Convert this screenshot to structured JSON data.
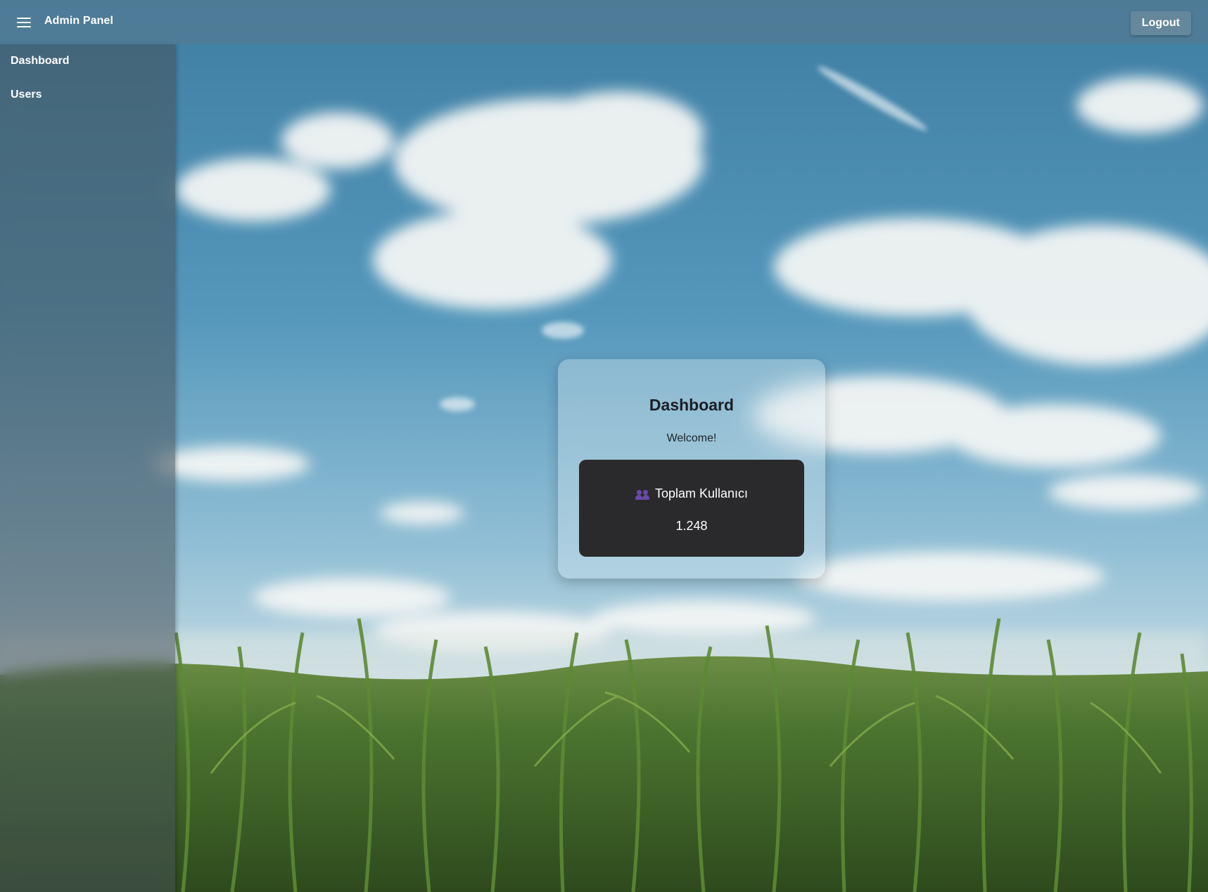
{
  "header": {
    "title": "Admin Panel",
    "menu_icon": "hamburger-menu-icon",
    "logout_label": "Logout"
  },
  "sidebar": {
    "items": [
      {
        "label": "Dashboard"
      },
      {
        "label": "Users"
      }
    ]
  },
  "main": {
    "card": {
      "title": "Dashboard",
      "welcome": "Welcome!",
      "stat": {
        "icon": "users-icon",
        "label": "Toplam Kullanıcı",
        "value": "1.248"
      }
    }
  },
  "colors": {
    "stat_box_bg": "#2a2a2c",
    "users_icon": "#6a4aa8",
    "sky": "#4f8fb0",
    "field": "#3f6a2a"
  }
}
